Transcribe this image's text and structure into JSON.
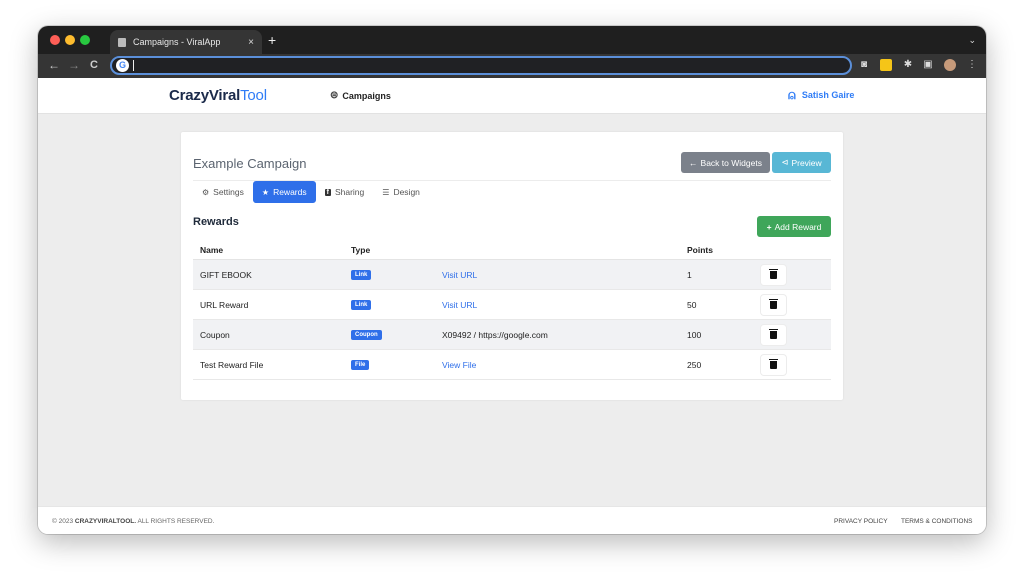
{
  "browser": {
    "tab_title": "Campaigns - ViralApp",
    "tab_close": "×",
    "new_tab": "+",
    "tab_menu": "⌄",
    "back": "←",
    "forward": "→",
    "reload": "C",
    "omnibox_logo": "G",
    "omnibox_value": ""
  },
  "navbar": {
    "brand_bold": "CrazyViral",
    "brand_light": "Tool",
    "campaigns_label": "Campaigns",
    "user_name": "Satish Gaire"
  },
  "campaign": {
    "title": "Example Campaign",
    "back_button": "Back to Widgets",
    "preview_button": "Preview",
    "tabs": [
      {
        "label": "Settings",
        "icon": "cogs-icon",
        "active": false
      },
      {
        "label": "Rewards",
        "icon": "star-icon",
        "active": true
      },
      {
        "label": "Sharing",
        "icon": "facebook-icon",
        "active": false
      },
      {
        "label": "Design",
        "icon": "list-icon",
        "active": false
      }
    ]
  },
  "rewards": {
    "heading": "Rewards",
    "add_button": "Add Reward",
    "columns": {
      "name": "Name",
      "type": "Type",
      "points": "Points"
    },
    "rows": [
      {
        "name": "GIFT EBOOK",
        "type": "Link",
        "detail": "Visit URL",
        "detail_is_link": true,
        "points": "1"
      },
      {
        "name": "URL Reward",
        "type": "Link",
        "detail": "Visit URL",
        "detail_is_link": true,
        "points": "50"
      },
      {
        "name": "Coupon",
        "type": "Coupon",
        "detail": "X09492 / https://google.com",
        "detail_is_link": false,
        "points": "100"
      },
      {
        "name": "Test Reward File",
        "type": "File",
        "detail": "View File",
        "detail_is_link": true,
        "points": "250"
      }
    ]
  },
  "footer": {
    "copyright_prefix": "© 2023",
    "copyright_brand": "CRAZYVIRALTOOL.",
    "copyright_suffix": "ALL RIGHTS RESERVED.",
    "privacy": "PRIVACY POLICY",
    "terms": "TERMS & CONDITIONS"
  },
  "colors": {
    "primary": "#2f6fe9",
    "success": "#3fa65a",
    "info": "#58b7d5",
    "secondary": "#7b818b"
  }
}
